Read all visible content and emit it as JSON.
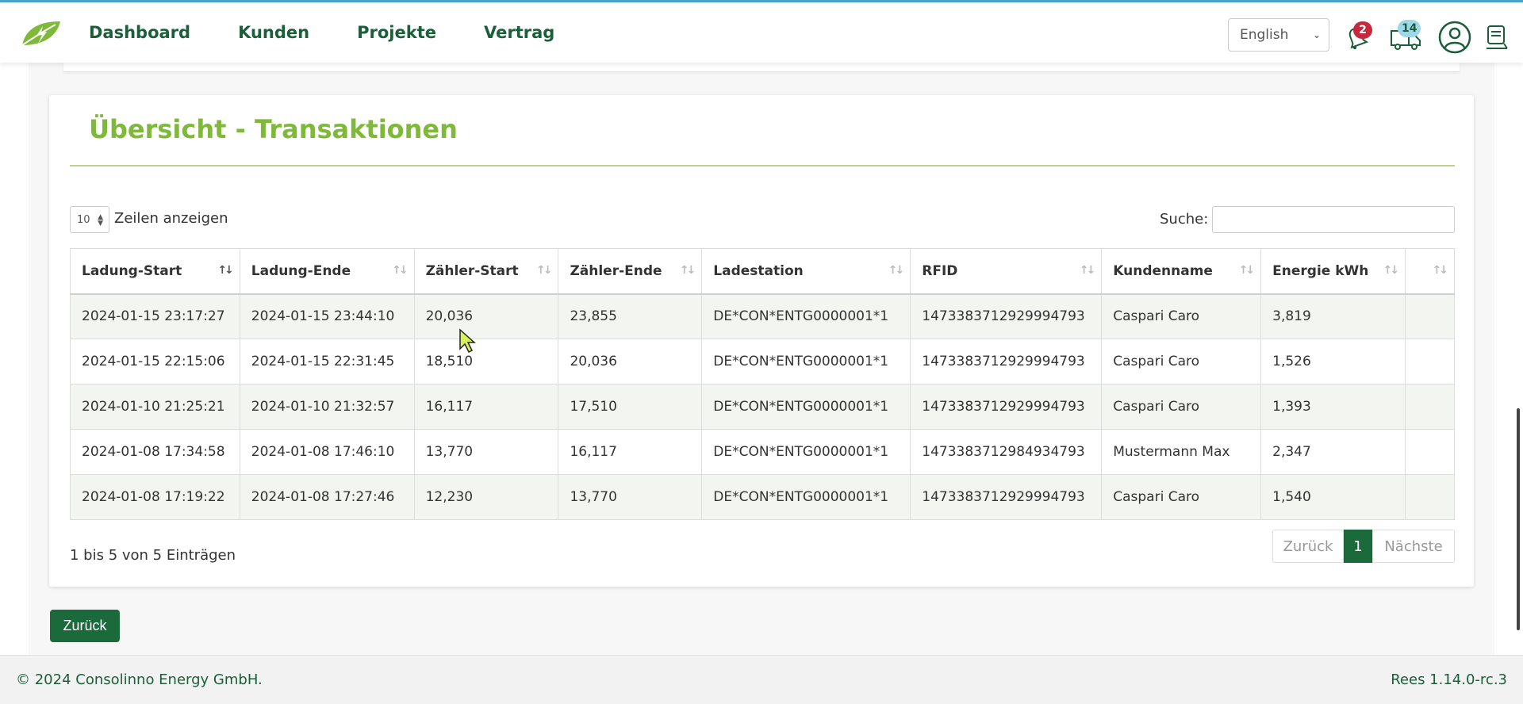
{
  "header": {
    "nav": [
      "Dashboard",
      "Kunden",
      "Projekte",
      "Vertrag"
    ],
    "language": "English",
    "notifications_count": "2",
    "updates_count": "14",
    "colors": {
      "brand": "#1b5e3a",
      "accent": "#7fb93a",
      "notification_badge": "#c8283c",
      "updates_badge": "#9fd7e8"
    }
  },
  "card": {
    "title": "Übersicht - Transaktionen",
    "length_value": "10",
    "length_label": "Zeilen anzeigen",
    "search_label": "Suche:",
    "search_value": ""
  },
  "table": {
    "columns": [
      "Ladung-Start",
      "Ladung-Ende",
      "Zähler-Start",
      "Zähler-Ende",
      "Ladestation",
      "RFID",
      "Kundenname",
      "Energie kWh",
      ""
    ],
    "rows": [
      [
        "2024-01-15 23:17:27",
        "2024-01-15 23:44:10",
        "20,036",
        "23,855",
        "DE*CON*ENTG0000001*1",
        "1473383712929994793",
        "Caspari Caro",
        "3,819",
        ""
      ],
      [
        "2024-01-15 22:15:06",
        "2024-01-15 22:31:45",
        "18,510",
        "20,036",
        "DE*CON*ENTG0000001*1",
        "1473383712929994793",
        "Caspari Caro",
        "1,526",
        ""
      ],
      [
        "2024-01-10 21:25:21",
        "2024-01-10 21:32:57",
        "16,117",
        "17,510",
        "DE*CON*ENTG0000001*1",
        "1473383712929994793",
        "Caspari Caro",
        "1,393",
        ""
      ],
      [
        "2024-01-08 17:34:58",
        "2024-01-08 17:46:10",
        "13,770",
        "16,117",
        "DE*CON*ENTG0000001*1",
        "1473383712984934793",
        "Mustermann Max",
        "2,347",
        ""
      ],
      [
        "2024-01-08 17:19:22",
        "2024-01-08 17:27:46",
        "12,230",
        "13,770",
        "DE*CON*ENTG0000001*1",
        "1473383712929994793",
        "Caspari Caro",
        "1,540",
        ""
      ]
    ],
    "info": "1 bis 5 von 5 Einträgen",
    "pagination": {
      "prev": "Zurück",
      "current": "1",
      "next": "Nächste"
    }
  },
  "back_button": "Zurück",
  "footer": {
    "copyright": "© 2024 Consolinno Energy GmbH.",
    "version": "Rees 1.14.0-rc.3"
  }
}
